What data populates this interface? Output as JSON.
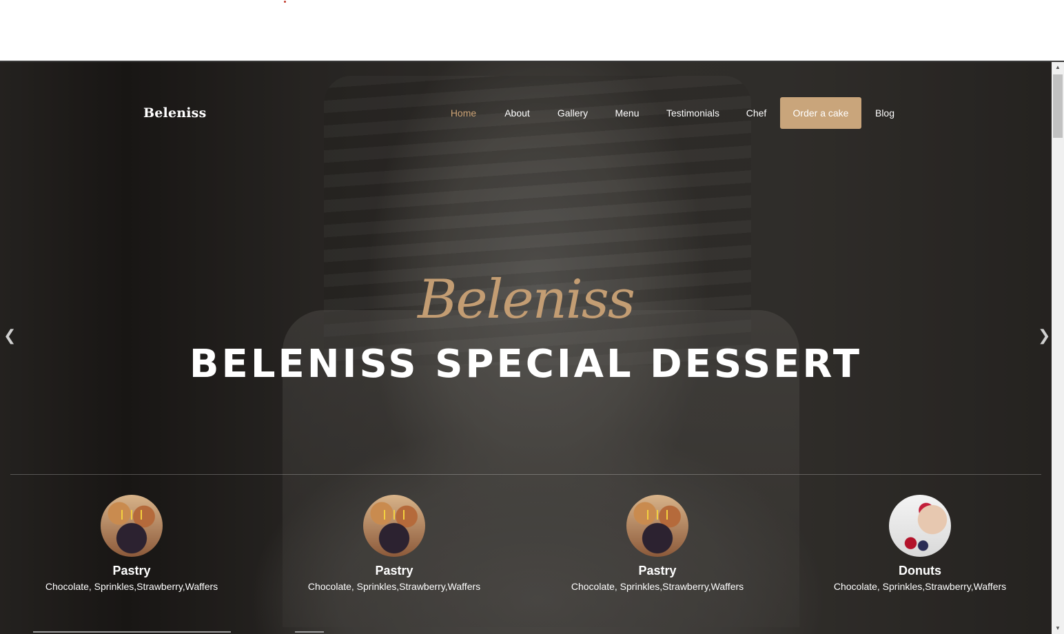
{
  "site": {
    "brand": "Beleniss"
  },
  "nav": {
    "items": [
      {
        "label": "Home",
        "active": true
      },
      {
        "label": "About"
      },
      {
        "label": "Gallery"
      },
      {
        "label": "Menu"
      },
      {
        "label": "Testimonials"
      },
      {
        "label": "Chef"
      },
      {
        "label": "Order a cake",
        "cta": true
      },
      {
        "label": "Blog"
      }
    ]
  },
  "hero": {
    "script_title": "Beleniss",
    "title": "BELENISS SPECIAL DESSERT",
    "prev_icon": "chevron-left-icon",
    "next_icon": "chevron-right-icon"
  },
  "products": [
    {
      "name": "Pastry",
      "description": "Chocolate, Sprinkles,Strawberry,Waffers",
      "image": "bundt-cake-candles"
    },
    {
      "name": "Pastry",
      "description": "Chocolate, Sprinkles,Strawberry,Waffers",
      "image": "bundt-cake-candles"
    },
    {
      "name": "Pastry",
      "description": "Chocolate, Sprinkles,Strawberry,Waffers",
      "image": "bundt-cake-candles"
    },
    {
      "name": "Donuts",
      "description": "Chocolate, Sprinkles,Strawberry,Waffers",
      "image": "cheesecake-berries"
    }
  ],
  "colors": {
    "accent": "#c9a57b",
    "active_nav": "#cda477",
    "script_title": "#c39d73"
  }
}
